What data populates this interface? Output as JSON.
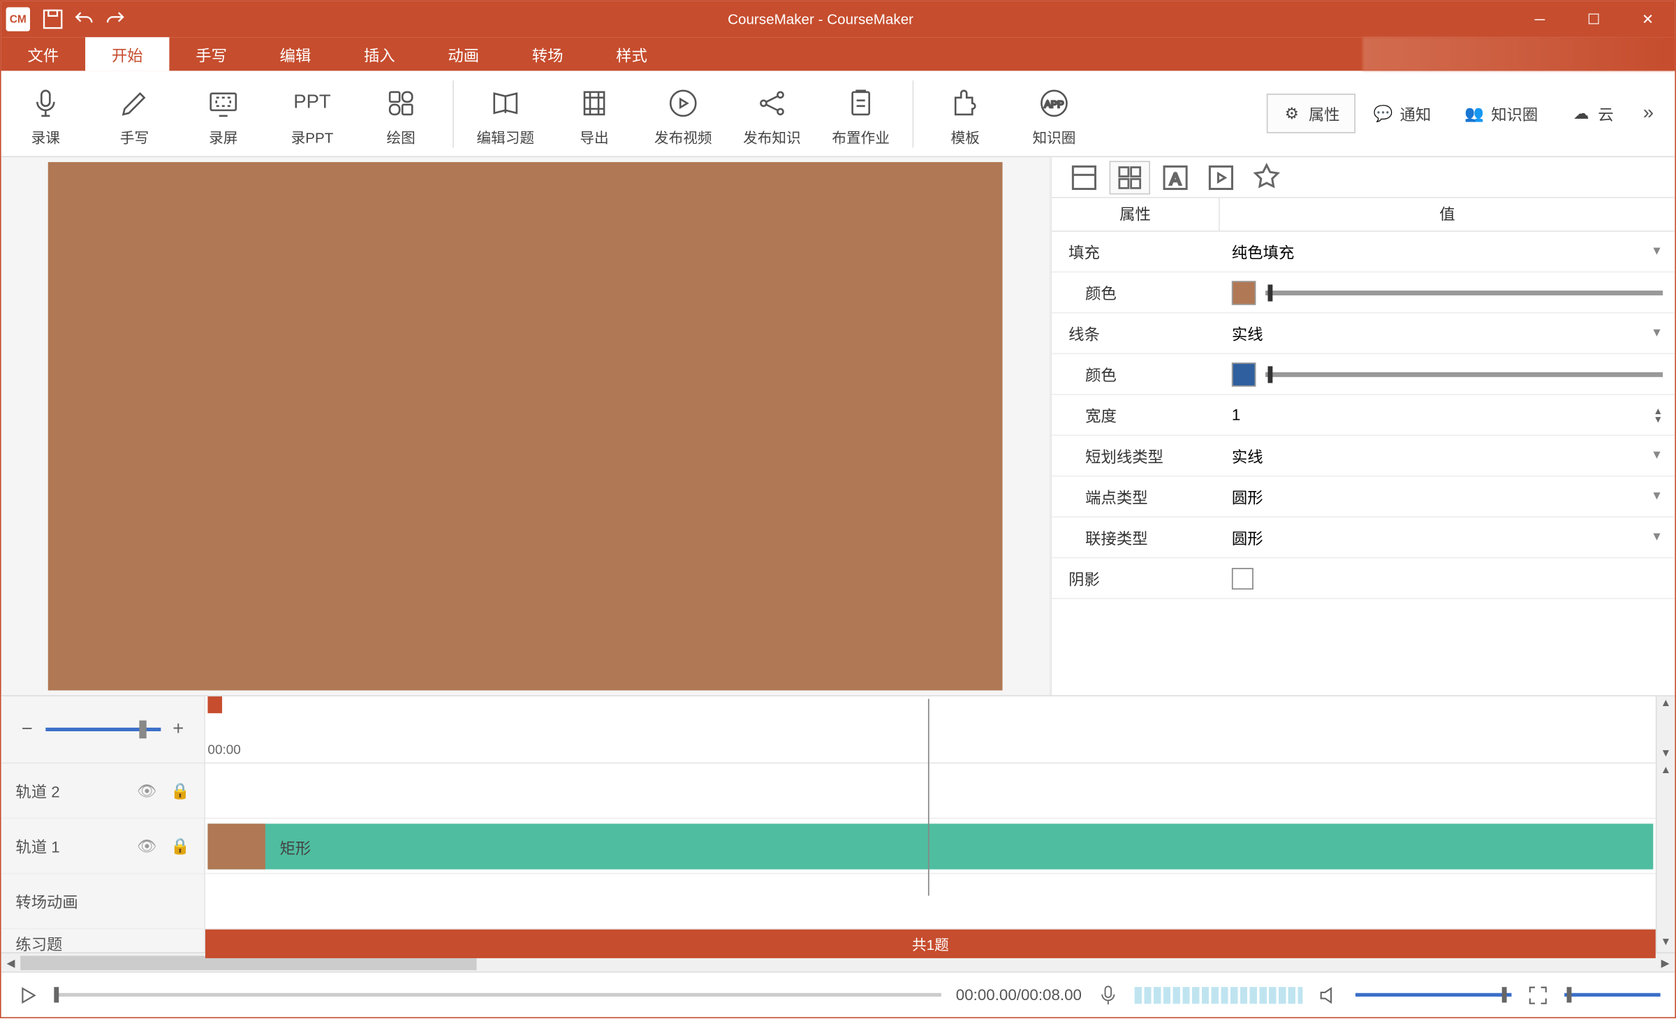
{
  "title": "CourseMaker - CourseMaker",
  "logo": "CM",
  "menu": {
    "items": [
      "文件",
      "开始",
      "手写",
      "编辑",
      "插入",
      "动画",
      "转场",
      "样式"
    ],
    "activeIndex": 1
  },
  "ribbon": {
    "buttons": [
      "录课",
      "手写",
      "录屏",
      "录PPT",
      "绘图",
      "编辑习题",
      "导出",
      "发布视频",
      "发布知识",
      "布置作业",
      "模板",
      "知识圈"
    ]
  },
  "rightTabs": {
    "attrs": "属性",
    "notify": "通知",
    "circle": "知识圈",
    "cloud": "云"
  },
  "panel": {
    "header": {
      "prop": "属性",
      "val": "值"
    },
    "fill": {
      "label": "填充",
      "value": "纯色填充"
    },
    "fillColor": {
      "label": "颜色",
      "swatch": "#b07854"
    },
    "line": {
      "label": "线条",
      "value": "实线"
    },
    "lineColor": {
      "label": "颜色",
      "swatch": "#2f5f9e"
    },
    "width": {
      "label": "宽度",
      "value": "1"
    },
    "dash": {
      "label": "短划线类型",
      "value": "实线"
    },
    "cap": {
      "label": "端点类型",
      "value": "圆形"
    },
    "join": {
      "label": "联接类型",
      "value": "圆形"
    },
    "shadow": {
      "label": "阴影"
    }
  },
  "timeline": {
    "rulerStart": "00:00",
    "tracks": {
      "t2": "轨道 2",
      "t1": "轨道 1",
      "trans": "转场动画",
      "ex": "练习题"
    },
    "clipLabel": "矩形",
    "exerciseSummary": "共1题"
  },
  "playbar": {
    "time": "00:00.00/00:08.00"
  }
}
